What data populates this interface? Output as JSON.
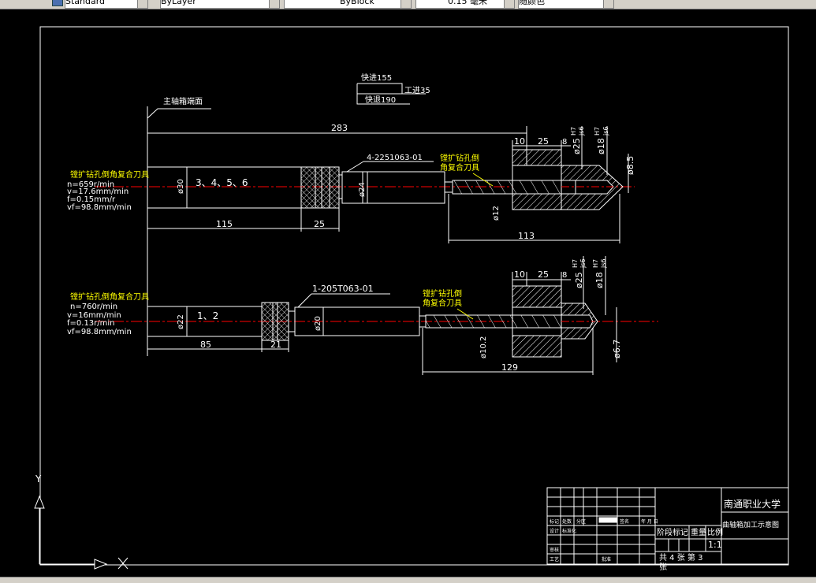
{
  "toolbar": {
    "textstyle_value": "Standard",
    "layer_value": "ByLayer",
    "linetype_value": "ByBlock",
    "lineweight_value": "0.15 毫米",
    "plotstyle_value": "随颜色"
  },
  "colors": {
    "background": "#000000",
    "lines": "#ffffff",
    "annotation": "#ffff00",
    "centerline": "#ff0000",
    "part_outline": "#ffffff"
  },
  "drawing": {
    "spindle_face_label": "主轴箱端面",
    "total_length": "283",
    "feed": {
      "fast_advance": "快进155",
      "work_feed": "工进35",
      "fast_return": "快退190"
    },
    "tool1": {
      "params_title": "镗扩钻孔倒角复合刀具",
      "speed": "n=659r/min",
      "cut_speed": "v=17.6mm/min",
      "feed": "f=0.15mm/r",
      "feed_rate": "vf=98.8mm/min",
      "shank_dia": "ø30",
      "shank_len": "115",
      "positions": "3、4、5、6",
      "nut_len": "25",
      "part_no": "4-2251063-01",
      "extension_dia": "ø24",
      "tool_name_l1": "镗扩钻孔倒",
      "tool_name_l2": "角复合刀具",
      "tool_dia": "ø12",
      "tool_len": "113",
      "dim_10": "10",
      "dim_25": "25",
      "dim_8": "8",
      "fit1": "ø25",
      "fit1_tol_top": "H7",
      "fit1_tol_bottom": "js6",
      "fit2": "ø18",
      "fit2_tol_top": "H7",
      "fit2_tol_bottom": "js6",
      "hole_dia": "ø8.5"
    },
    "tool2": {
      "params_title": "镗扩钻孔倒角复合刀具",
      "speed": "n=760r/min",
      "cut_speed": "v=16mm/min",
      "feed": "f=0.13r/min",
      "feed_rate": "vf=98.8mm/min",
      "shank_dia": "ø22",
      "shank_len": "85",
      "positions": "1、2",
      "nut_len": "21",
      "part_no": "1-205T063-01",
      "extension_dia": "ø20",
      "tool_name_l1": "镗扩钻孔倒",
      "tool_name_l2": "角复合刀具",
      "tool_dia": "ø10.2",
      "tool_len": "129",
      "dim_10": "10",
      "dim_25": "25",
      "dim_8": "8",
      "fit1": "ø25",
      "fit1_tol_top": "H7",
      "fit1_tol_bottom": "js6",
      "fit2": "ø18",
      "fit2_tol_top": "H7",
      "fit2_tol_bottom": "js6",
      "hole_dia": "ø6.7"
    }
  },
  "title_block": {
    "school": "南通职业大学",
    "drawing_title": "曲轴箱加工示意图",
    "stage_label": "阶段标记",
    "weight_label": "重量",
    "scale_label": "比例",
    "scale_value": "1:1",
    "sheets_text": "共 4 张  第 3",
    "sheets_text_cont": "张",
    "mark_label": "标记",
    "count_label": "处数",
    "zone_label": "分区",
    "sign_label": "签名",
    "date_label": "年 月 日",
    "design_label": "设计",
    "standard_label": "标准化",
    "review_label": "审核",
    "process_label": "工艺",
    "approve_label": "批准"
  },
  "ucs": {
    "y_label": "Y",
    "x_label": "X"
  }
}
